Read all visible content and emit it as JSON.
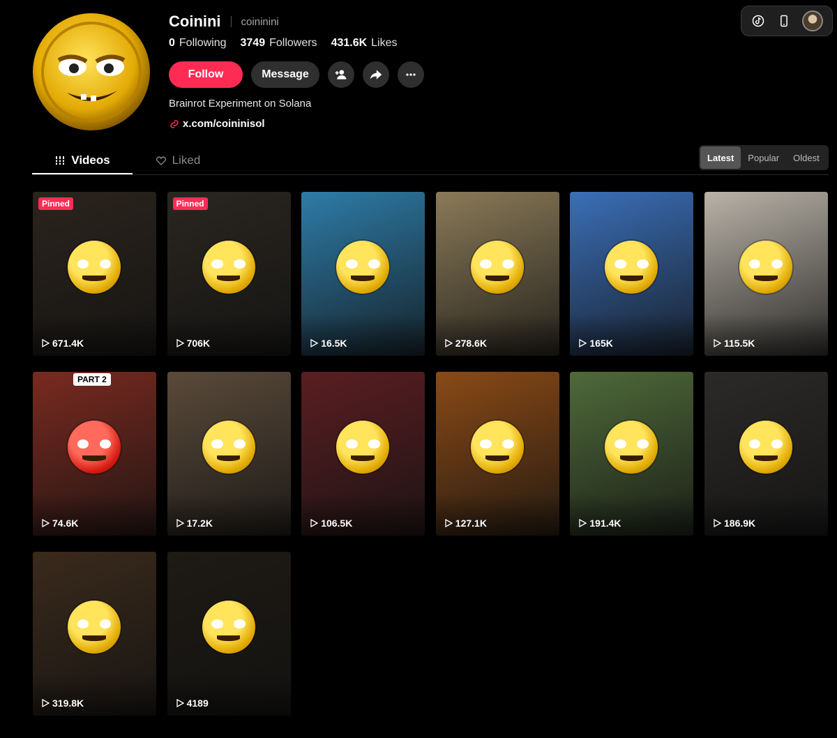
{
  "profile": {
    "display_name": "Coinini",
    "username": "coininini",
    "bio": "Brainrot Experiment on Solana",
    "link": "x.com/coininisol",
    "avatar_icon": "coin-face-avatar"
  },
  "stats": {
    "following_value": "0",
    "following_label": "Following",
    "followers_value": "3749",
    "followers_label": "Followers",
    "likes_value": "431.6K",
    "likes_label": "Likes"
  },
  "actions": {
    "follow_label": "Follow",
    "message_label": "Message",
    "add_friend_icon": "add-friend-icon",
    "share_icon": "share-icon",
    "more_icon": "more-icon"
  },
  "top_controls": {
    "icons": [
      "tiktok-icon",
      "phone-icon",
      "user-avatar"
    ]
  },
  "tabs": [
    {
      "label": "Videos",
      "icon": "grid-icon",
      "active": true
    },
    {
      "label": "Liked",
      "icon": "heart-lock-icon",
      "active": false
    }
  ],
  "sort": [
    "Latest",
    "Popular",
    "Oldest"
  ],
  "sort_selected": "Latest",
  "pinned_label": "Pinned",
  "videos": [
    {
      "views": "671.4K",
      "pinned": true,
      "bg": "#2b241d",
      "coin": "yellow"
    },
    {
      "views": "706K",
      "pinned": true,
      "bg": "#2a2620",
      "coin": "yellow"
    },
    {
      "views": "16.5K",
      "pinned": false,
      "bg": "#2e7ca8",
      "coin": "yellow"
    },
    {
      "views": "278.6K",
      "pinned": false,
      "bg": "#8a7a58",
      "coin": "yellow"
    },
    {
      "views": "165K",
      "pinned": false,
      "bg": "#3b6fb8",
      "coin": "yellow"
    },
    {
      "views": "115.5K",
      "pinned": false,
      "bg": "#b9b3a8",
      "coin": "yellow"
    },
    {
      "views": "74.6K",
      "pinned": false,
      "bg": "#7a2a20",
      "coin": "red",
      "caption": "PART 2"
    },
    {
      "views": "17.2K",
      "pinned": false,
      "bg": "#5a4a3a",
      "coin": "yellow"
    },
    {
      "views": "106.5K",
      "pinned": false,
      "bg": "#5a1e22",
      "coin": "yellow"
    },
    {
      "views": "127.1K",
      "pinned": false,
      "bg": "#8a4a16",
      "coin": "yellow"
    },
    {
      "views": "191.4K",
      "pinned": false,
      "bg": "#4f6a3a",
      "coin": "yellow"
    },
    {
      "views": "186.9K",
      "pinned": false,
      "bg": "#2c2a28",
      "coin": "yellow"
    },
    {
      "views": "319.8K",
      "pinned": false,
      "bg": "#3a2a1c",
      "coin": "yellow"
    },
    {
      "views": "4189",
      "pinned": false,
      "bg": "#1e1a14",
      "coin": "yellow"
    }
  ],
  "colors": {
    "accent": "#fe2c55",
    "button_dark": "#2f2f2f",
    "background": "#000000"
  }
}
